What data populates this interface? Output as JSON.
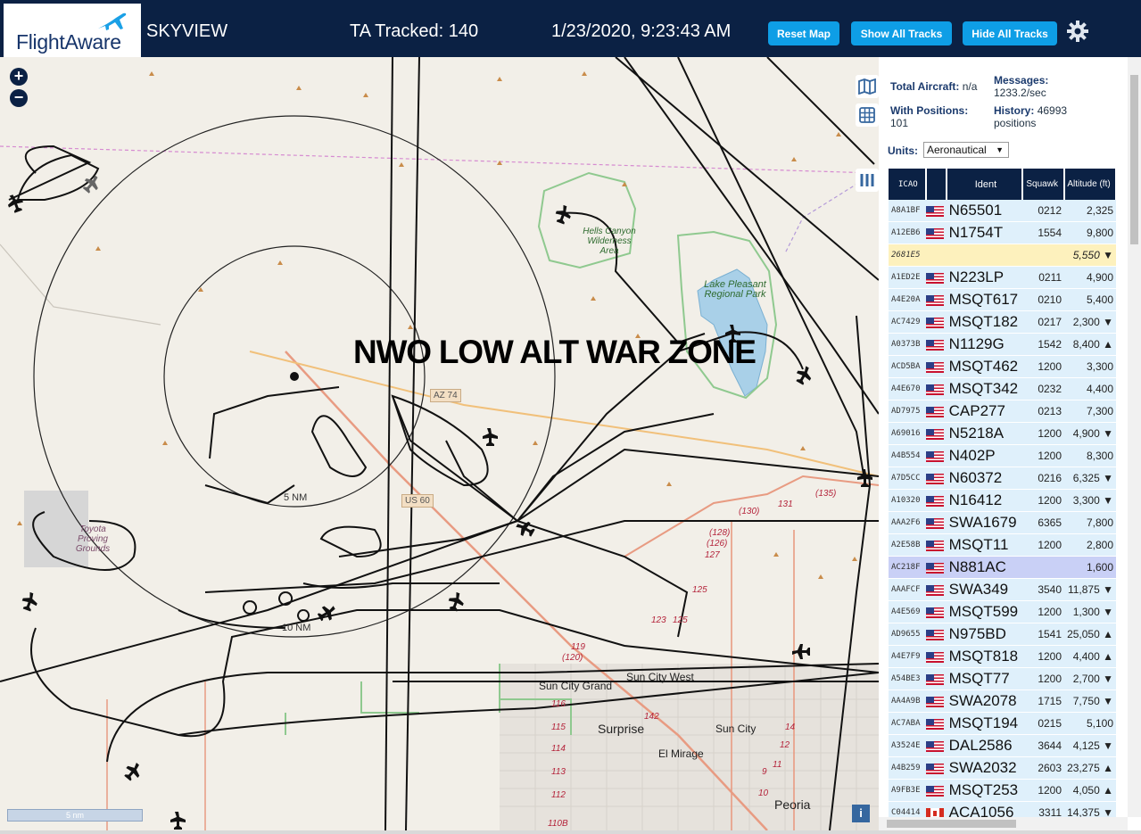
{
  "header": {
    "logo_text": "FlightAware",
    "app_name": "SKYVIEW",
    "tracked_label": "TA Tracked: 140",
    "datetime": "1/23/2020, 9:23:43 AM",
    "buttons": {
      "reset_map": "Reset Map",
      "show_all": "Show All Tracks",
      "hide_all": "Hide All Tracks"
    },
    "settings_icon": "gear-icon"
  },
  "map": {
    "zoom_in": "+",
    "zoom_out": "−",
    "overlay_title": "NWO LOW ALT WAR ZONE",
    "ring_labels": [
      "5 NM",
      "10 NM"
    ],
    "scale_label": "5 nm",
    "info_label": "i",
    "places": {
      "hells_canyon": "Hells Canyon Wilderness Area",
      "lake_pleasant": "Lake Pleasant Regional Park",
      "toyota": "Toyota Proving Grounds",
      "sun_city_grand": "Sun City Grand",
      "sun_city_west": "Sun City West",
      "surprise": "Surprise",
      "sun_city": "Sun City",
      "el_mirage": "El Mirage",
      "peoria": "Peoria"
    },
    "highways": {
      "az74": "AZ 74",
      "us60": "US 60"
    },
    "routes": [
      "(135)",
      "(130)",
      "131",
      "(128)",
      "(126)",
      "127",
      "125",
      "123",
      "125",
      "119",
      "(120)",
      "116",
      "115",
      "114",
      "113",
      "112",
      "110B",
      "142",
      "14",
      "12",
      "11",
      "10",
      "9"
    ],
    "colors": {
      "track": "#111111",
      "land": "#f2efe8",
      "water": "#a9d0e8",
      "park_outline": "#8fc98f",
      "road_major": "#e89b82"
    }
  },
  "stats": {
    "total_aircraft_label": "Total Aircraft:",
    "total_aircraft_value": "n/a",
    "with_positions_label": "With Positions:",
    "with_positions_value": "101",
    "messages_label": "Messages:",
    "messages_value": "1233.2/sec",
    "history_label": "History:",
    "history_value": "46993 positions"
  },
  "units": {
    "label": "Units:",
    "value": "Aeronautical"
  },
  "table": {
    "columns": [
      "ICAO",
      "",
      "Ident",
      "Squawk",
      "Altitude (ft)"
    ],
    "rows": [
      {
        "icao": "A8A1BF",
        "flag": "us",
        "ident": "N65501",
        "squawk": "0212",
        "alt": "2,325"
      },
      {
        "icao": "A12EB6",
        "flag": "us",
        "ident": "N1754T",
        "squawk": "1554",
        "alt": "9,800"
      },
      {
        "icao": "2681E5",
        "flag": "",
        "ident": "",
        "squawk": "",
        "alt": "5,550 ▼"
      },
      {
        "icao": "A1ED2E",
        "flag": "us",
        "ident": "N223LP",
        "squawk": "0211",
        "alt": "4,900"
      },
      {
        "icao": "A4E20A",
        "flag": "us",
        "ident": "MSQT617",
        "squawk": "0210",
        "alt": "5,400"
      },
      {
        "icao": "AC7429",
        "flag": "us",
        "ident": "MSQT182",
        "squawk": "0217",
        "alt": "2,300 ▼"
      },
      {
        "icao": "A0373B",
        "flag": "us",
        "ident": "N1129G",
        "squawk": "1542",
        "alt": "8,400 ▲"
      },
      {
        "icao": "ACD5BA",
        "flag": "us",
        "ident": "MSQT462",
        "squawk": "1200",
        "alt": "3,300"
      },
      {
        "icao": "A4E670",
        "flag": "us",
        "ident": "MSQT342",
        "squawk": "0232",
        "alt": "4,400"
      },
      {
        "icao": "AD7975",
        "flag": "us",
        "ident": "CAP277",
        "squawk": "0213",
        "alt": "7,300"
      },
      {
        "icao": "A69016",
        "flag": "us",
        "ident": "N5218A",
        "squawk": "1200",
        "alt": "4,900 ▼"
      },
      {
        "icao": "A4B554",
        "flag": "us",
        "ident": "N402P",
        "squawk": "1200",
        "alt": "8,300"
      },
      {
        "icao": "A7D5CC",
        "flag": "us",
        "ident": "N60372",
        "squawk": "0216",
        "alt": "6,325 ▼"
      },
      {
        "icao": "A10320",
        "flag": "us",
        "ident": "N16412",
        "squawk": "1200",
        "alt": "3,300 ▼"
      },
      {
        "icao": "AAA2F6",
        "flag": "us",
        "ident": "SWA1679",
        "squawk": "6365",
        "alt": "7,800"
      },
      {
        "icao": "A2E58B",
        "flag": "us",
        "ident": "MSQT11",
        "squawk": "1200",
        "alt": "2,800"
      },
      {
        "icao": "AC218F",
        "flag": "us",
        "ident": "N881AC",
        "squawk": "",
        "alt": "1,600"
      },
      {
        "icao": "AAAFCF",
        "flag": "us",
        "ident": "SWA349",
        "squawk": "3540",
        "alt": "11,875 ▼"
      },
      {
        "icao": "A4E569",
        "flag": "us",
        "ident": "MSQT599",
        "squawk": "1200",
        "alt": "1,300 ▼"
      },
      {
        "icao": "AD9655",
        "flag": "us",
        "ident": "N975BD",
        "squawk": "1541",
        "alt": "25,050 ▲"
      },
      {
        "icao": "A4E7F9",
        "flag": "us",
        "ident": "MSQT818",
        "squawk": "1200",
        "alt": "4,400 ▲"
      },
      {
        "icao": "A54BE3",
        "flag": "us",
        "ident": "MSQT77",
        "squawk": "1200",
        "alt": "2,700 ▼"
      },
      {
        "icao": "AA4A9B",
        "flag": "us",
        "ident": "SWA2078",
        "squawk": "1715",
        "alt": "7,750 ▼"
      },
      {
        "icao": "AC7ABA",
        "flag": "us",
        "ident": "MSQT194",
        "squawk": "0215",
        "alt": "5,100"
      },
      {
        "icao": "A3524E",
        "flag": "us",
        "ident": "DAL2586",
        "squawk": "3644",
        "alt": "4,125 ▼"
      },
      {
        "icao": "A4B259",
        "flag": "us",
        "ident": "SWA2032",
        "squawk": "2603",
        "alt": "23,275 ▲"
      },
      {
        "icao": "A9FB3E",
        "flag": "us",
        "ident": "MSQT253",
        "squawk": "1200",
        "alt": "4,050 ▲"
      },
      {
        "icao": "C04414",
        "flag": "ca",
        "ident": "ACA1056",
        "squawk": "3311",
        "alt": "14,375 ▼"
      }
    ]
  }
}
